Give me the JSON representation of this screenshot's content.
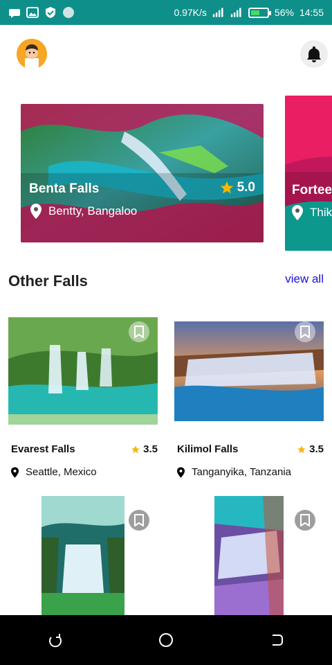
{
  "status": {
    "speed": "0.97K/s",
    "battery": "56%",
    "time": "14:55",
    "battery_level": 0.56
  },
  "header": {
    "avatar": "avatar-boy",
    "notification_icon": "bell-icon"
  },
  "featured": [
    {
      "name": "Benta Falls",
      "rating": "5.0",
      "location": "Bentty, Bangaloo"
    },
    {
      "name": "Fortee",
      "location": "Thik"
    }
  ],
  "section": {
    "title": "Other Falls",
    "view_all": "view all"
  },
  "falls": [
    {
      "name": "Evarest Falls",
      "rating": "3.5",
      "location": "Seattle, Mexico"
    },
    {
      "name": "Kilimol Falls",
      "rating": "3.5",
      "location": "Tanganyika, Tanzania"
    },
    {
      "name": "",
      "rating": "",
      "location": ""
    },
    {
      "name": "",
      "rating": "",
      "location": ""
    }
  ],
  "colors": {
    "status_bar": "#0f8f8a",
    "link": "#1a0fd8",
    "star": "#f5b800"
  }
}
